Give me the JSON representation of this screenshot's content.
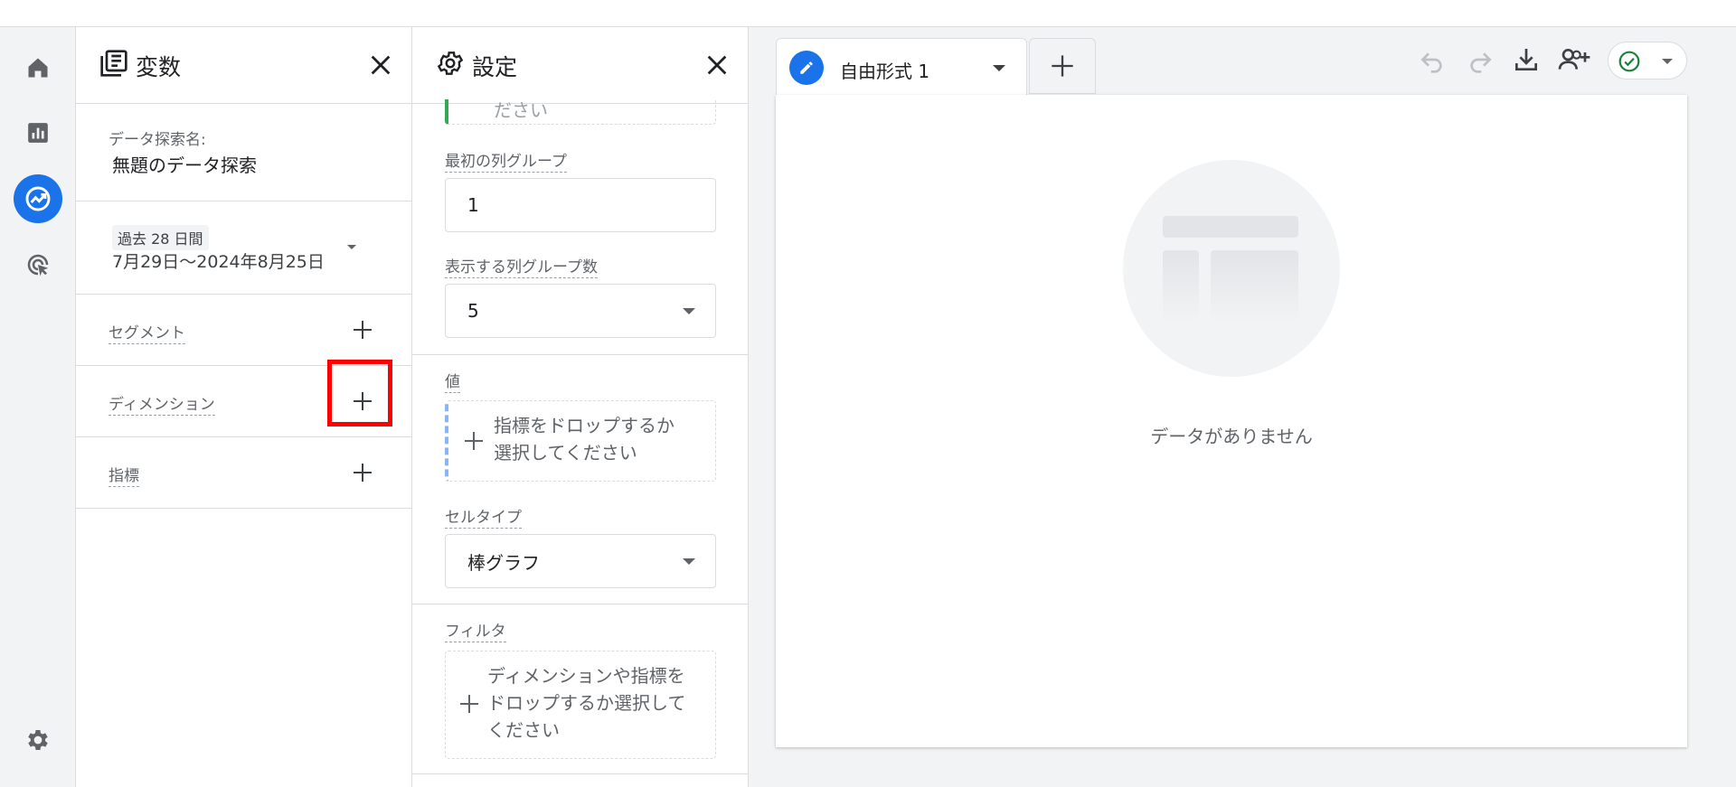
{
  "variables_panel": {
    "title": "変数",
    "exploration_name_label": "データ探索名:",
    "exploration_name": "無題のデータ探索",
    "date_range_chip": "過去 28 日間",
    "date_range_value": "7月29日～2024年8月25日",
    "segments_label": "セグメント",
    "dimensions_label": "ディメンション",
    "metrics_label": "指標"
  },
  "settings_panel": {
    "title": "設定",
    "partial_top_text": "ださい",
    "first_column_group_label": "最初の列グループ",
    "first_column_group_value": "1",
    "column_groups_shown_label": "表示する列グループ数",
    "column_groups_shown_value": "5",
    "values_label": "値",
    "values_drop_text_line1": "指標をドロップするか",
    "values_drop_text_line2": "選択してください",
    "cell_type_label": "セルタイプ",
    "cell_type_value": "棒グラフ",
    "filter_label": "フィルタ",
    "filter_drop_line1": "ディメンションや指標を",
    "filter_drop_line2": "ドロップするか選択して",
    "filter_drop_line3": "ください"
  },
  "canvas": {
    "tab_label": "自由形式 1",
    "empty_message": "データがありません"
  },
  "colors": {
    "accent": "#1a73e8",
    "highlight": "#ff0000",
    "status_ok": "#188038"
  }
}
